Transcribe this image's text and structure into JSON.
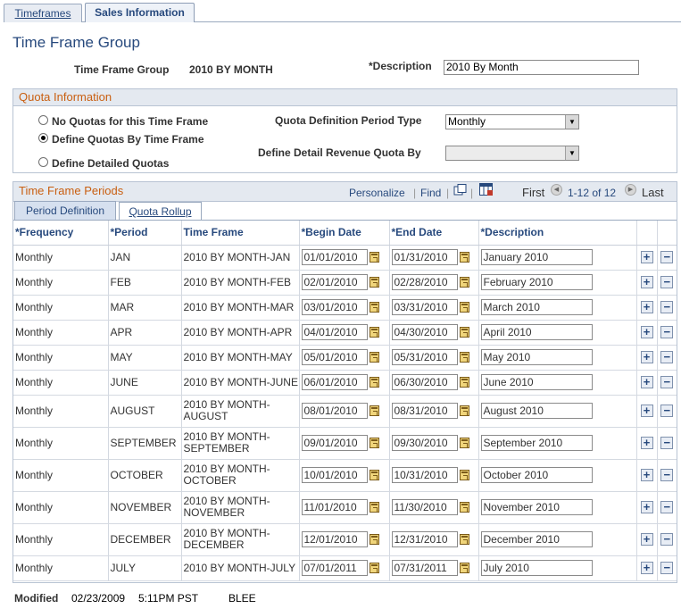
{
  "tabs": [
    {
      "label": "Timeframes",
      "active": false
    },
    {
      "label": "Sales Information",
      "active": true
    }
  ],
  "page_title": "Time Frame Group",
  "header": {
    "group_label": "Time Frame Group",
    "group_value": "2010 BY MONTH",
    "description_label": "*Description",
    "description_value": "2010 By Month"
  },
  "quota": {
    "title": "Quota Information",
    "options": [
      {
        "label": "No Quotas for this Time Frame",
        "selected": false
      },
      {
        "label": "Define Quotas By Time Frame",
        "selected": true
      },
      {
        "label": "Define Detailed Quotas",
        "selected": false
      }
    ],
    "period_type_label": "Quota Definition Period Type",
    "period_type_value": "Monthly",
    "detail_label": "Define Detail Revenue Quota By",
    "detail_value": ""
  },
  "periods": {
    "title": "Time Frame Periods",
    "personalize": "Personalize",
    "find": "Find",
    "first": "First",
    "range": "1-12 of 12",
    "last": "Last",
    "subtabs": [
      {
        "label": "Period Definition",
        "active": true
      },
      {
        "label": "Quota Rollup",
        "active": false
      }
    ],
    "columns": [
      "*Frequency",
      "*Period",
      "Time Frame",
      "*Begin Date",
      "*End Date",
      "*Description"
    ],
    "rows": [
      {
        "frequency": "Monthly",
        "period": "JAN",
        "timeframe": "2010 BY MONTH-JAN",
        "begin": "01/01/2010",
        "end": "01/31/2010",
        "description": "January 2010"
      },
      {
        "frequency": "Monthly",
        "period": "FEB",
        "timeframe": "2010 BY MONTH-FEB",
        "begin": "02/01/2010",
        "end": "02/28/2010",
        "description": "February 2010"
      },
      {
        "frequency": "Monthly",
        "period": "MAR",
        "timeframe": "2010 BY MONTH-MAR",
        "begin": "03/01/2010",
        "end": "03/31/2010",
        "description": "March 2010"
      },
      {
        "frequency": "Monthly",
        "period": "APR",
        "timeframe": "2010 BY MONTH-APR",
        "begin": "04/01/2010",
        "end": "04/30/2010",
        "description": "April 2010"
      },
      {
        "frequency": "Monthly",
        "period": "MAY",
        "timeframe": "2010 BY MONTH-MAY",
        "begin": "05/01/2010",
        "end": "05/31/2010",
        "description": "May 2010"
      },
      {
        "frequency": "Monthly",
        "period": "JUNE",
        "timeframe": "2010 BY MONTH-JUNE",
        "begin": "06/01/2010",
        "end": "06/30/2010",
        "description": "June 2010"
      },
      {
        "frequency": "Monthly",
        "period": "AUGUST",
        "timeframe": "2010 BY MONTH-AUGUST",
        "begin": "08/01/2010",
        "end": "08/31/2010",
        "description": "August 2010"
      },
      {
        "frequency": "Monthly",
        "period": "SEPTEMBER",
        "timeframe": "2010 BY MONTH-SEPTEMBER",
        "begin": "09/01/2010",
        "end": "09/30/2010",
        "description": "September 2010"
      },
      {
        "frequency": "Monthly",
        "period": "OCTOBER",
        "timeframe": "2010 BY MONTH-OCTOBER",
        "begin": "10/01/2010",
        "end": "10/31/2010",
        "description": "October 2010"
      },
      {
        "frequency": "Monthly",
        "period": "NOVEMBER",
        "timeframe": "2010 BY MONTH-NOVEMBER",
        "begin": "11/01/2010",
        "end": "11/30/2010",
        "description": "November 2010"
      },
      {
        "frequency": "Monthly",
        "period": "DECEMBER",
        "timeframe": "2010 BY MONTH-DECEMBER",
        "begin": "12/01/2010",
        "end": "12/31/2010",
        "description": "December 2010"
      },
      {
        "frequency": "Monthly",
        "period": "JULY",
        "timeframe": "2010 BY MONTH-JULY",
        "begin": "07/01/2011",
        "end": "07/31/2011",
        "description": "July 2010"
      }
    ]
  },
  "footer": {
    "modified_label": "Modified",
    "modified_date": "02/23/2009",
    "modified_time": "5:11PM PST",
    "modified_by": "BLEE"
  },
  "icons": {
    "calendar": "calendar-icon",
    "add_row": "plus-icon",
    "delete_row": "minus-icon",
    "view_all": "view-all-icon",
    "download": "download-icon",
    "prev": "chevron-left-icon",
    "next": "chevron-right-icon"
  },
  "colors": {
    "title_blue": "#27497d",
    "section_orange": "#c95f11",
    "header_bg": "#e4e9f0"
  }
}
